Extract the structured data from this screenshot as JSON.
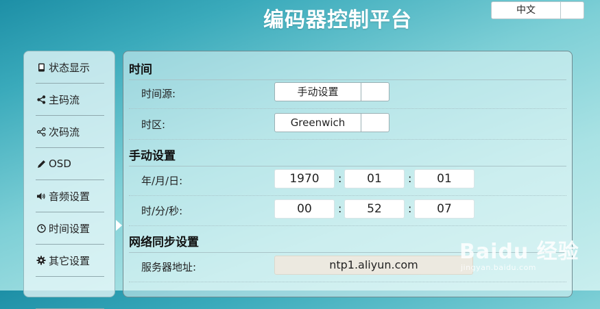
{
  "header": {
    "title": "编码器控制平台",
    "language": "中文"
  },
  "sidebar": {
    "items": [
      {
        "label": "状态显示",
        "icon": "phone-icon"
      },
      {
        "label": "主码流",
        "icon": "share-icon"
      },
      {
        "label": "次码流",
        "icon": "share-icon"
      },
      {
        "label": "OSD",
        "icon": "pencil-icon"
      },
      {
        "label": "音频设置",
        "icon": "speaker-icon"
      },
      {
        "label": "时间设置",
        "icon": "clock-icon"
      },
      {
        "label": "其它设置",
        "icon": "gear-icon"
      }
    ],
    "active": "时间设置"
  },
  "main": {
    "time_section": {
      "title": "时间",
      "time_source_label": "时间源:",
      "time_source_value": "手动设置",
      "timezone_label": "时区:",
      "timezone_value": "Greenwich"
    },
    "manual_section": {
      "title": "手动设置",
      "date_label": "年/月/日:",
      "year": "1970",
      "month": "01",
      "day": "01",
      "time_label": "时/分/秒:",
      "hour": "00",
      "minute": "52",
      "second": "07",
      "separator": ":"
    },
    "sync_section": {
      "title": "网络同步设置",
      "server_label": "服务器地址:",
      "server_value": "ntp1.aliyun.com"
    }
  },
  "watermark": {
    "main": "Baidu 经验",
    "sub": "jingyan.baidu.com"
  }
}
